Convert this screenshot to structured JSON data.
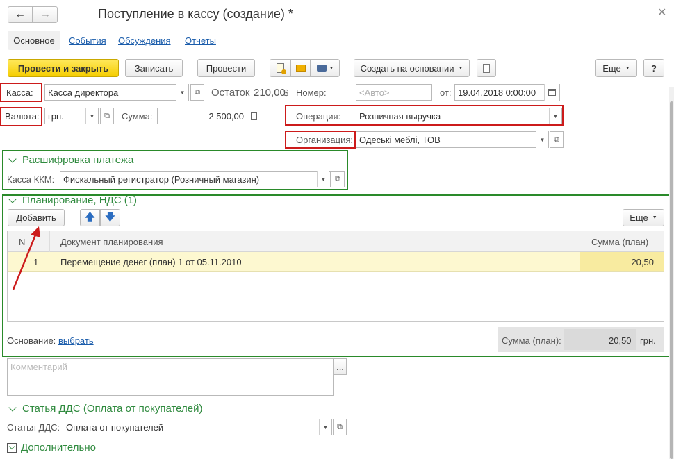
{
  "window": {
    "title": "Поступление в кассу (создание) *"
  },
  "tabs": [
    "Основное",
    "События",
    "Обсуждения",
    "Отчеты"
  ],
  "toolbar": {
    "post_close": "Провести и закрыть",
    "save": "Записать",
    "post": "Провести",
    "create_based": "Создать на основании",
    "more": "Еще",
    "help": "?"
  },
  "form": {
    "cash_label": "Касса:",
    "cash_value": "Касса директора",
    "balance_label": "Остаток",
    "balance_value": "210,00",
    "balance_currency": "$",
    "number_label": "Номер:",
    "number_placeholder": "<Авто>",
    "date_label": "от:",
    "date_value": "19.04.2018  0:00:00",
    "currency_label": "Валюта:",
    "currency_value": "грн.",
    "sum_label": "Сумма:",
    "sum_value": "2 500,00",
    "operation_label": "Операция:",
    "operation_value": "Розничная выручка",
    "org_label": "Организация:",
    "org_value": "Одеські меблі, ТОВ"
  },
  "payment_section": {
    "title": "Расшифровка платежа",
    "kkm_label": "Касса ККМ:",
    "kkm_value": "Фискальный регистратор (Розничный магазин)"
  },
  "planning_section": {
    "title": "Планирование, НДС (1)",
    "add_button": "Добавить",
    "more": "Еще",
    "columns": [
      "N",
      "Документ планирования",
      "Сумма (план)"
    ],
    "rows": [
      {
        "n": "1",
        "doc": "Перемещение денег (план) 1 от 05.11.2010",
        "sum": "20,50"
      }
    ],
    "basis_label": "Основание:",
    "basis_link": "выбрать",
    "total_label": "Сумма (план):",
    "total_value": "20,50",
    "total_currency": "грн."
  },
  "comment": {
    "placeholder": "Комментарий",
    "button": "..."
  },
  "dds_section": {
    "title": "Статья ДДС (Оплата от покупателей)",
    "label": "Статья ДДС:",
    "value": "Оплата от покупателей"
  },
  "extra_section": {
    "title": "Дополнительно"
  },
  "colors": {
    "accent_yellow": "#f5cd00",
    "section_green": "#2f8a3e",
    "highlight_red": "#cc1b1b",
    "row_highlight": "#fdf8d0",
    "link_blue": "#1a5cab"
  }
}
